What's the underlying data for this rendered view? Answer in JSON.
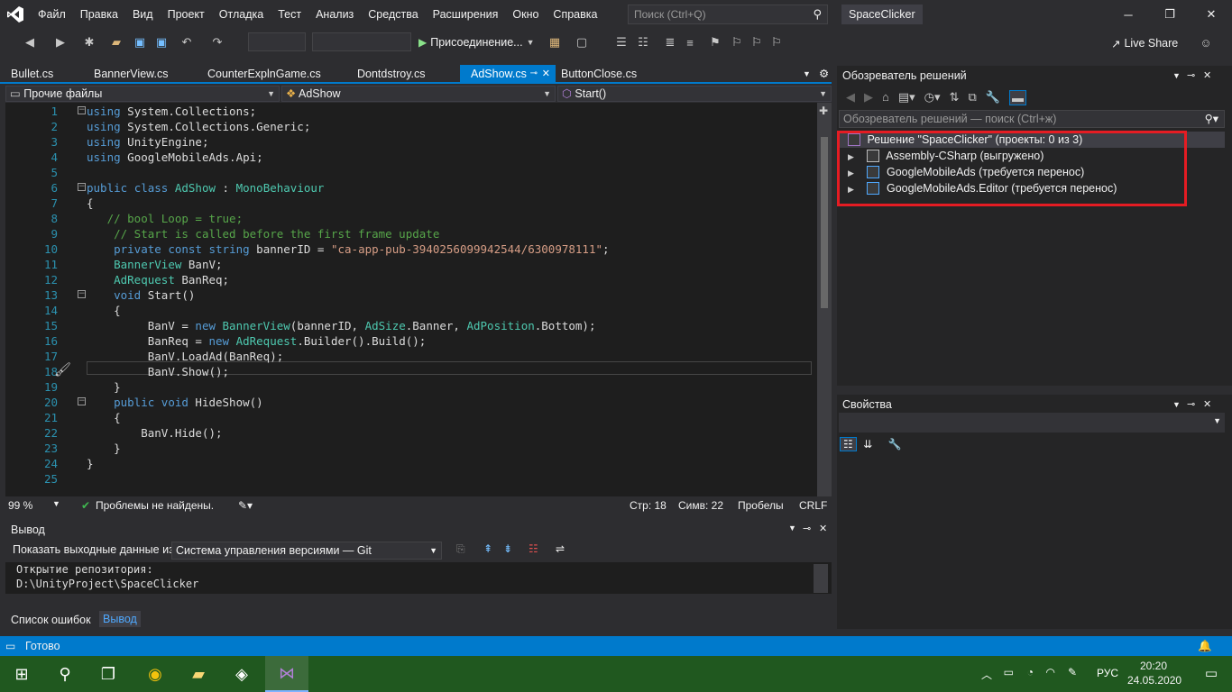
{
  "menu": {
    "items": [
      "Файл",
      "Правка",
      "Вид",
      "Проект",
      "Отладка",
      "Тест",
      "Анализ",
      "Средства",
      "Расширения",
      "Окно",
      "Справка"
    ],
    "search_placeholder": "Поиск (Ctrl+Q)",
    "solution_name": "SpaceClicker"
  },
  "toolbar": {
    "attach_label": "Присоединение...",
    "liveshare_label": "Live Share"
  },
  "tabs": {
    "items": [
      "Bullet.cs",
      "BannerView.cs",
      "CounterExplnGame.cs",
      "Dontdstroy.cs",
      "AdShow.cs",
      "ButtonClose.cs"
    ],
    "active": "AdShow.cs"
  },
  "navbar": {
    "project": "Прочие файлы",
    "class": "AdShow",
    "member": "Start()"
  },
  "editor": {
    "lines": [
      {
        "n": "1",
        "text": "using System.Collections;"
      },
      {
        "n": "2",
        "text": "using System.Collections.Generic;"
      },
      {
        "n": "3",
        "text": "using UnityEngine;"
      },
      {
        "n": "4",
        "text": "using GoogleMobileAds.Api;"
      },
      {
        "n": "5",
        "text": ""
      },
      {
        "n": "6",
        "text": "public class AdShow : MonoBehaviour"
      },
      {
        "n": "7",
        "text": "{"
      },
      {
        "n": "8",
        "text": "   // bool Loop = true;"
      },
      {
        "n": "9",
        "text": "    // Start is called before the first frame update"
      },
      {
        "n": "10",
        "text": "    private const string bannerID = \"ca-app-pub-3940256099942544/6300978111\";"
      },
      {
        "n": "11",
        "text": "    BannerView BanV;"
      },
      {
        "n": "12",
        "text": "    AdRequest BanReq;"
      },
      {
        "n": "13",
        "text": "    void Start()"
      },
      {
        "n": "14",
        "text": "    {"
      },
      {
        "n": "15",
        "text": "         BanV = new BannerView(bannerID, AdSize.Banner, AdPosition.Bottom);"
      },
      {
        "n": "16",
        "text": "         BanReq = new AdRequest.Builder().Build();"
      },
      {
        "n": "17",
        "text": "         BanV.LoadAd(BanReq);"
      },
      {
        "n": "18",
        "text": "         BanV.Show();"
      },
      {
        "n": "19",
        "text": "    }"
      },
      {
        "n": "20",
        "text": "    public void HideShow()"
      },
      {
        "n": "21",
        "text": "    {"
      },
      {
        "n": "22",
        "text": "        BanV.Hide();"
      },
      {
        "n": "23",
        "text": "    }"
      },
      {
        "n": "24",
        "text": "}"
      },
      {
        "n": "25",
        "text": ""
      }
    ]
  },
  "editor_status": {
    "zoom": "99 %",
    "problems": "Проблемы не найдены.",
    "line": "Стр: 18",
    "col": "Симв: 22",
    "spaces": "Пробелы",
    "eol": "CRLF"
  },
  "output": {
    "title": "Вывод",
    "source_label": "Показать выходные данные из:",
    "source_value": "Система управления версиями — Git",
    "text": "Открытие репозитория:\nD:\\UnityProject\\SpaceClicker"
  },
  "bottom_tabs": [
    "Список ошибок",
    "Вывод"
  ],
  "solution_explorer": {
    "title": "Обозреватель решений",
    "search_placeholder": "Обозреватель решений — поиск (Ctrl+ж)",
    "root": "Решение \"SpaceClicker\" (проекты: 0 из 3)",
    "projects": [
      "Assembly-CSharp (выгружено)",
      "GoogleMobileAds (требуется перенос)",
      "GoogleMobileAds.Editor (требуется перенос)"
    ]
  },
  "properties": {
    "title": "Свойства"
  },
  "statusbar": {
    "text": "Готово"
  },
  "taskbar": {
    "lang": "РУС",
    "time": "20:20",
    "date": "24.05.2020"
  },
  "colors": {
    "accent": "#007acc",
    "highlight_box": "#e51c23",
    "taskbar": "#20581f"
  }
}
